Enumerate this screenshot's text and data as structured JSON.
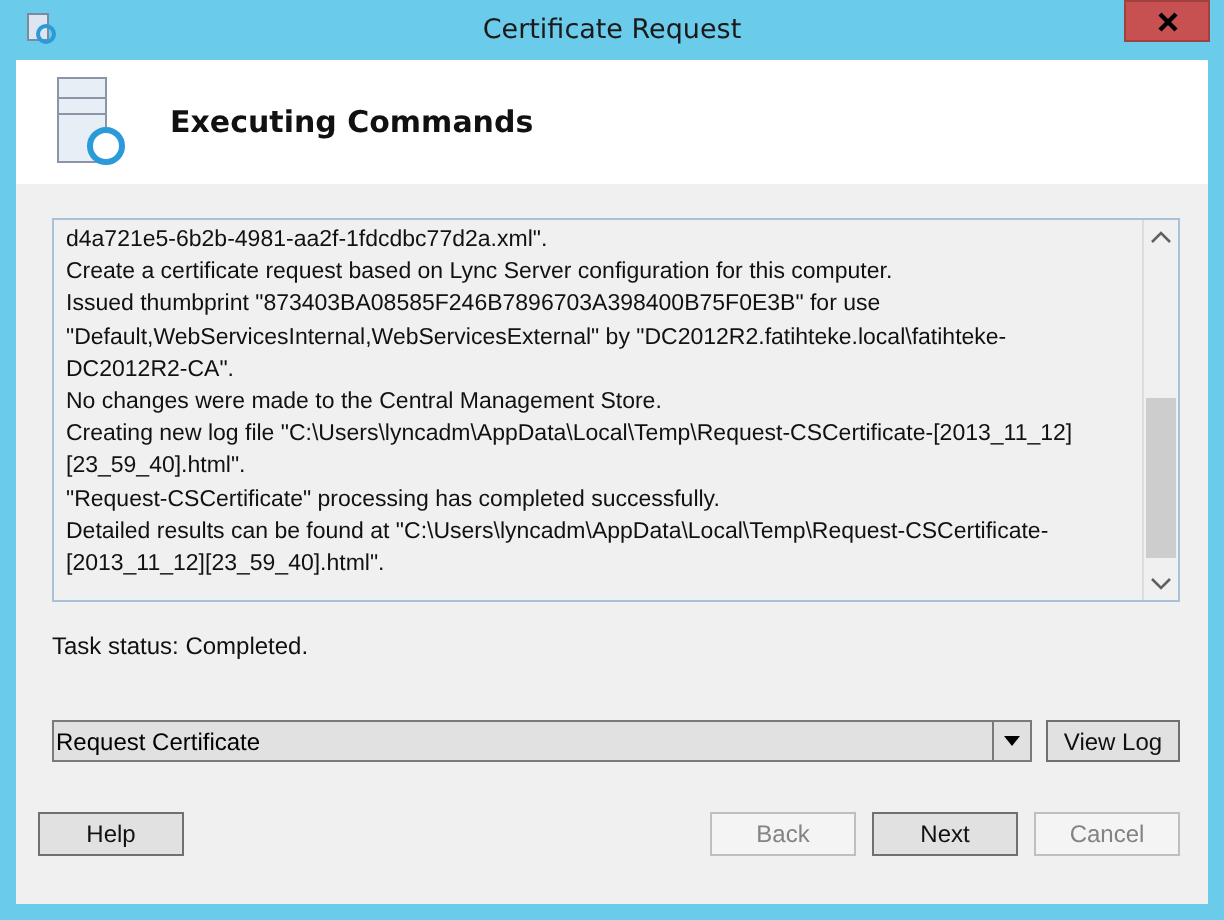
{
  "window": {
    "title": "Certificate Request"
  },
  "header": {
    "title": "Executing Commands"
  },
  "log_lines": [
    "d4a721e5-6b2b-4981-aa2f-1fdcdbc77d2a.xml\".",
    "Create a certificate request based on Lync Server configuration for this computer.",
    "Issued thumbprint \"873403BA08585F246B7896703A398400B75F0E3B\" for use",
    "\"Default,WebServicesInternal,WebServicesExternal\" by \"DC2012R2.fatihteke.local\\fatihteke-",
    "DC2012R2-CA\".",
    "No changes were made to the Central Management Store.",
    "Creating new log file \"C:\\Users\\lyncadm\\AppData\\Local\\Temp\\Request-CSCertificate-[2013_11_12]",
    "[23_59_40].html\".",
    "\"Request-CSCertificate\" processing has completed successfully.",
    "Detailed results can be found at \"C:\\Users\\lyncadm\\AppData\\Local\\Temp\\Request-CSCertificate-",
    "[2013_11_12][23_59_40].html\"."
  ],
  "task_status": "Task status: Completed.",
  "action_dropdown": {
    "value": "Request Certificate"
  },
  "view_log_button": {
    "label": "View Log",
    "disabled": false
  },
  "buttons": [
    {
      "label": "Help",
      "disabled": false
    },
    {
      "label": "Back",
      "disabled": true
    },
    {
      "label": "Next",
      "disabled": false
    },
    {
      "label": "Cancel",
      "disabled": true
    }
  ]
}
